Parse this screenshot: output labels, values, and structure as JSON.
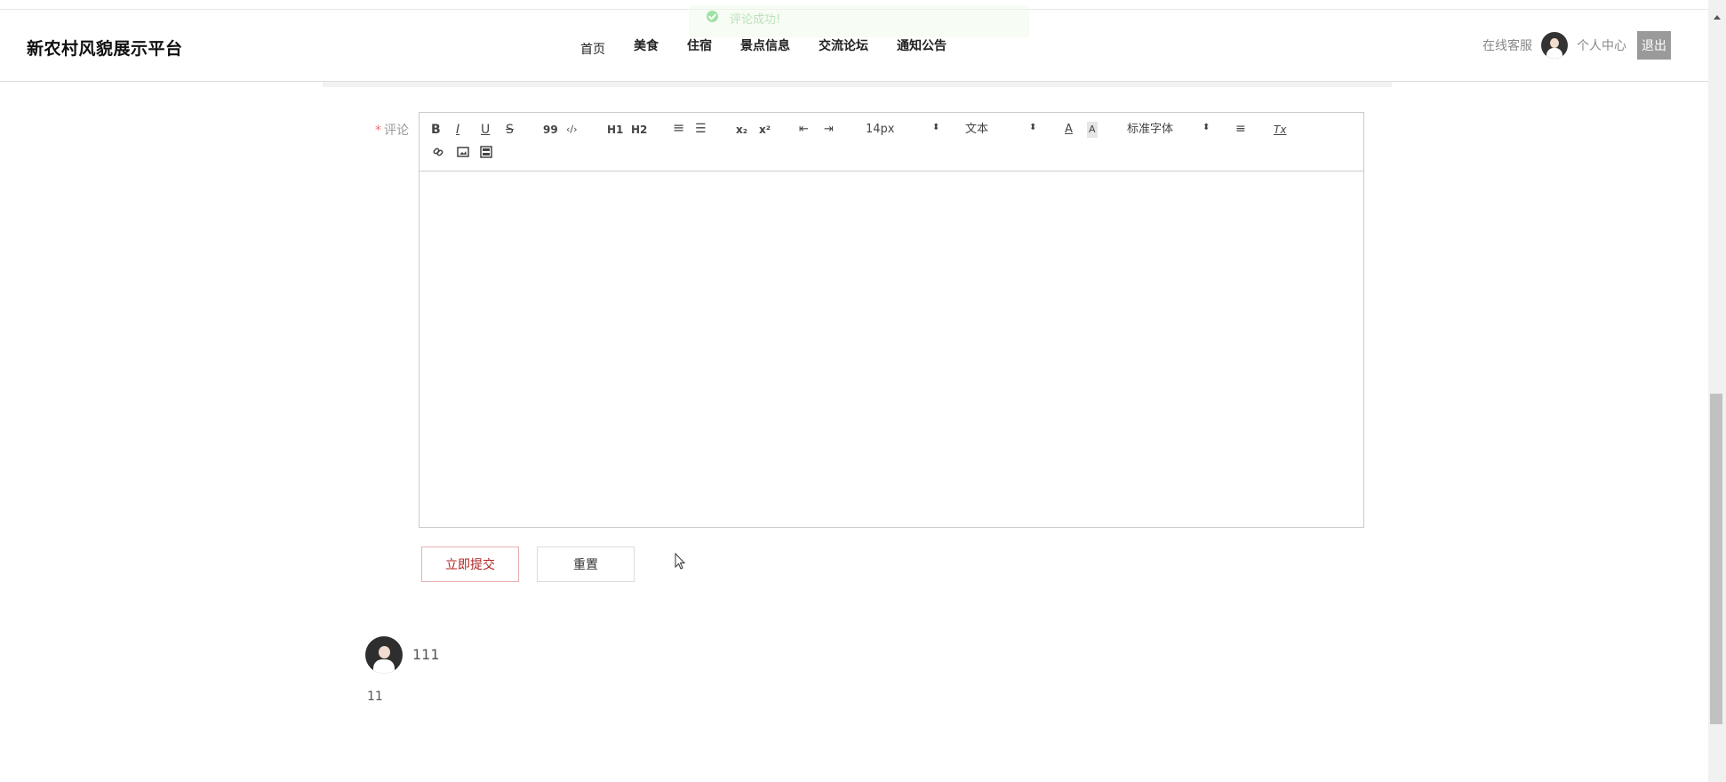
{
  "header": {
    "brand": "新农村风貌展示平台",
    "nav": [
      "首页",
      "美食",
      "住宿",
      "景点信息",
      "交流论坛",
      "通知公告"
    ],
    "service": "在线客服",
    "personal": "个人中心",
    "logout": "退出"
  },
  "toast": {
    "message": "评论成功!"
  },
  "form": {
    "required_mark": "*",
    "comment_label": "评论",
    "toolbar": {
      "bold": "B",
      "italic": "I",
      "underline": "U",
      "strike": "S",
      "blockquote": "99",
      "code": "‹/›",
      "h1": "H1",
      "h2": "H2",
      "ordered_list": "≡",
      "bullet_list": "☰",
      "subscript": "x₂",
      "superscript": "x²",
      "outdent": "⇤",
      "indent": "⇥",
      "size_value": "14px",
      "header_value": "文本",
      "font_value": "标准字体",
      "color": "A",
      "background": "A",
      "align": "≡",
      "clean": "Tx"
    },
    "submit": "立即提交",
    "reset": "重置"
  },
  "comments": [
    {
      "user": "111",
      "text": "11"
    }
  ],
  "colors": {
    "accent": "#b22222",
    "toast_bg": "#f0f9eb",
    "logout_bg": "#9a9a9a"
  }
}
